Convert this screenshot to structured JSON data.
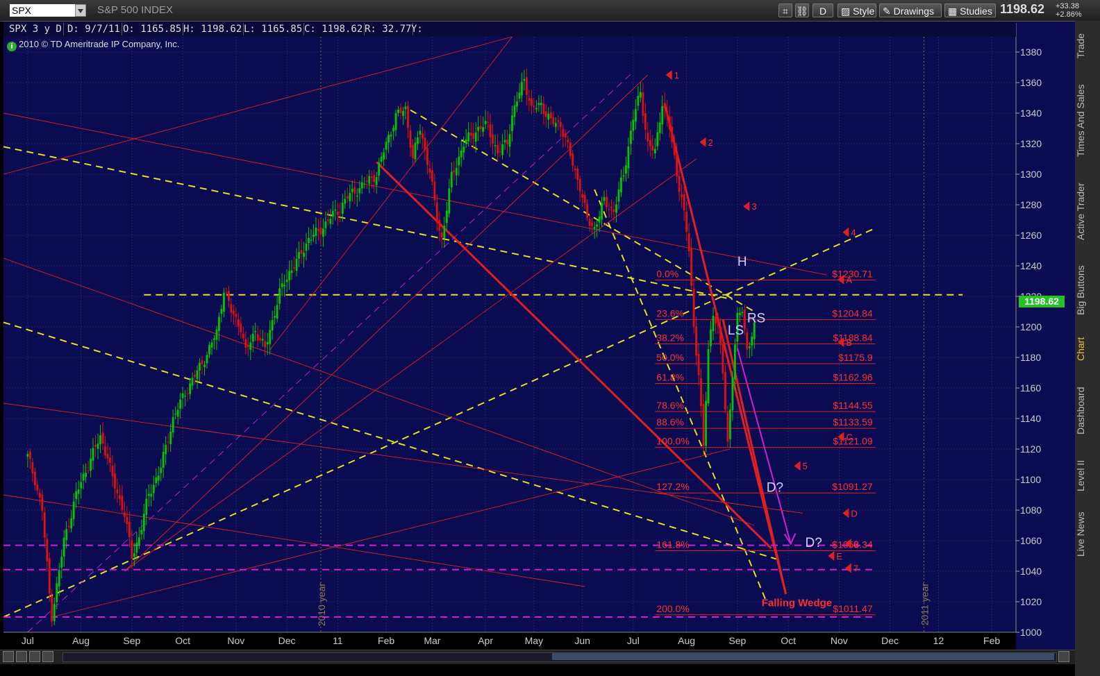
{
  "toolbar": {
    "symbol": "SPX",
    "title": "S&P 500 INDEX",
    "period_button": "D",
    "style_label": "Style",
    "drawings_label": "Drawings",
    "studies_label": "Studies",
    "last_price": "1198.62",
    "change": "+33.38",
    "change_pct": "+2.86%"
  },
  "info_bar": {
    "period": "SPX 3 y D",
    "date": "D: 9/7/11",
    "open": "O: 1165.85",
    "high": "H: 1198.62",
    "low": "L: 1165.85",
    "close": "C: 1198.62",
    "range": "R: 32.77",
    "y": "Y:"
  },
  "copyright": "2010 © TD Ameritrade IP Company, Inc.",
  "right_tabs": [
    "Trade",
    "Times And Sales",
    "Active Trader",
    "Big Buttons",
    "Chart",
    "Dashboard",
    "Level II",
    "Live News"
  ],
  "colors": {
    "background": "#0b0b52",
    "grid": "#5a5a88",
    "up": "#00c800",
    "down": "#e01010",
    "fib": "#e02020",
    "yellow": "#e8e020",
    "magenta": "#d020d0",
    "text_red": "#ff3030",
    "price_tag": "#22c322"
  },
  "chart_data": {
    "type": "candlestick",
    "symbol": "SPX",
    "ylim": [
      1000,
      1390
    ],
    "y_ticks": [
      1000,
      1020,
      1040,
      1060,
      1080,
      1100,
      1120,
      1140,
      1160,
      1180,
      1200,
      1220,
      1240,
      1260,
      1280,
      1300,
      1320,
      1340,
      1360,
      1380
    ],
    "x_labels": [
      "Jul",
      "Aug",
      "Sep",
      "Oct",
      "Nov",
      "Dec",
      "11",
      "Feb",
      "Mar",
      "Apr",
      "May",
      "Jun",
      "Jul",
      "Aug",
      "Sep",
      "Oct",
      "Nov",
      "Dec",
      "12",
      "Feb"
    ],
    "x_tick_index": [
      0,
      22,
      43,
      64,
      86,
      107,
      128,
      148,
      167,
      189,
      209,
      229,
      250,
      272,
      293,
      314,
      335,
      356,
      376,
      398
    ],
    "x_range": [
      -10,
      408
    ],
    "year_markers": [
      {
        "text": "2010 year",
        "x": 121
      },
      {
        "text": "2011 year",
        "x": 370
      }
    ],
    "current_price": "1198.62",
    "price_anchors": [
      [
        0,
        1115
      ],
      [
        3,
        1100
      ],
      [
        6,
        1080
      ],
      [
        9,
        1025
      ],
      [
        10,
        1011
      ],
      [
        12,
        1030
      ],
      [
        15,
        1060
      ],
      [
        20,
        1090
      ],
      [
        25,
        1110
      ],
      [
        30,
        1128
      ],
      [
        33,
        1115
      ],
      [
        35,
        1100
      ],
      [
        40,
        1078
      ],
      [
        43,
        1049
      ],
      [
        46,
        1063
      ],
      [
        50,
        1090
      ],
      [
        55,
        1108
      ],
      [
        60,
        1140
      ],
      [
        66,
        1160
      ],
      [
        72,
        1176
      ],
      [
        78,
        1196
      ],
      [
        81,
        1225
      ],
      [
        84,
        1210
      ],
      [
        88,
        1200
      ],
      [
        90,
        1183
      ],
      [
        94,
        1198
      ],
      [
        98,
        1185
      ],
      [
        100,
        1198
      ],
      [
        104,
        1222
      ],
      [
        108,
        1236
      ],
      [
        112,
        1245
      ],
      [
        116,
        1258
      ],
      [
        120,
        1262
      ],
      [
        124,
        1270
      ],
      [
        128,
        1276
      ],
      [
        132,
        1285
      ],
      [
        136,
        1290
      ],
      [
        140,
        1295
      ],
      [
        144,
        1300
      ],
      [
        148,
        1320
      ],
      [
        152,
        1338
      ],
      [
        156,
        1343
      ],
      [
        159,
        1310
      ],
      [
        162,
        1330
      ],
      [
        166,
        1302
      ],
      [
        169,
        1270
      ],
      [
        171,
        1258
      ],
      [
        175,
        1298
      ],
      [
        180,
        1320
      ],
      [
        186,
        1330
      ],
      [
        190,
        1332
      ],
      [
        194,
        1313
      ],
      [
        198,
        1322
      ],
      [
        200,
        1338
      ],
      [
        205,
        1363
      ],
      [
        208,
        1342
      ],
      [
        212,
        1346
      ],
      [
        216,
        1334
      ],
      [
        220,
        1333
      ],
      [
        224,
        1312
      ],
      [
        228,
        1292
      ],
      [
        231,
        1270
      ],
      [
        234,
        1265
      ],
      [
        238,
        1282
      ],
      [
        242,
        1276
      ],
      [
        246,
        1300
      ],
      [
        250,
        1337
      ],
      [
        253,
        1353
      ],
      [
        256,
        1320
      ],
      [
        259,
        1314
      ],
      [
        262,
        1348
      ],
      [
        265,
        1330
      ],
      [
        268,
        1300
      ],
      [
        270,
        1285
      ],
      [
        273,
        1250
      ],
      [
        275,
        1200
      ],
      [
        277,
        1170
      ],
      [
        279,
        1120
      ],
      [
        281,
        1185
      ],
      [
        283,
        1210
      ],
      [
        285,
        1200
      ],
      [
        287,
        1170
      ],
      [
        289,
        1124
      ],
      [
        291,
        1170
      ],
      [
        293,
        1205
      ],
      [
        295,
        1212
      ],
      [
        297,
        1185
      ],
      [
        300,
        1199
      ]
    ],
    "trendlines": [
      {
        "color": "yellow",
        "dash": true,
        "from": [
          -10,
          1318
        ],
        "to": [
          291,
          1218
        ]
      },
      {
        "color": "yellow",
        "dash": true,
        "from": [
          -10,
          1203
        ],
        "to": [
          309,
          1048
        ]
      },
      {
        "color": "yellow",
        "dash": true,
        "from": [
          -10,
          1010
        ],
        "to": [
          349,
          1264
        ]
      },
      {
        "color": "yellow",
        "dash": true,
        "from": [
          48,
          1221
        ],
        "to": [
          386,
          1221
        ]
      },
      {
        "color": "yellow",
        "dash": true,
        "from": [
          158,
          1342
        ],
        "to": [
          300,
          1210
        ]
      },
      {
        "color": "yellow",
        "dash": true,
        "from": [
          234,
          1290
        ],
        "to": [
          305,
          1020
        ]
      },
      {
        "color": "red",
        "width": 3,
        "from": [
          144,
          1308
        ],
        "to": [
          307,
          1055
        ]
      },
      {
        "color": "red",
        "width": 3,
        "from": [
          263,
          1346
        ],
        "to": [
          313,
          1025
        ]
      },
      {
        "color": "red",
        "width": 3,
        "from": [
          287,
          1205
        ],
        "to": [
          313,
          1025
        ]
      },
      {
        "color": "magenta",
        "width": 2,
        "from": [
          293,
          1186
        ],
        "to": [
          315,
          1058
        ]
      },
      {
        "color": "magenta",
        "dash": true,
        "from": [
          0,
          1000
        ],
        "to": [
          250,
          1367
        ]
      },
      {
        "color": "red",
        "from": [
          -10,
          1340
        ],
        "to": [
          330,
          1234
        ]
      },
      {
        "color": "red",
        "from": [
          -10,
          1300
        ],
        "to": [
          200,
          1390
        ]
      },
      {
        "color": "red",
        "from": [
          -10,
          1245
        ],
        "to": [
          300,
          1070
        ]
      },
      {
        "color": "red",
        "from": [
          -10,
          1150
        ],
        "to": [
          320,
          1078
        ]
      },
      {
        "color": "red",
        "from": [
          -10,
          1090
        ],
        "to": [
          230,
          1030
        ]
      },
      {
        "color": "red",
        "from": [
          40,
          1040
        ],
        "to": [
          256,
          1365
        ]
      },
      {
        "color": "red",
        "from": [
          40,
          1040
        ],
        "to": [
          276,
          1310
        ]
      },
      {
        "color": "red",
        "from": [
          100,
          1185
        ],
        "to": [
          200,
          1390
        ]
      },
      {
        "color": "red",
        "from": [
          10,
          1010
        ],
        "to": [
          290,
          1120
        ]
      }
    ],
    "fib_levels": [
      {
        "pct": "0.0%",
        "price": 1230.71,
        "label": "$1230.71"
      },
      {
        "pct": "23.6%",
        "price": 1204.84,
        "label": "$1204.84"
      },
      {
        "pct": "38.2%",
        "price": 1188.84,
        "label": "$1188.84"
      },
      {
        "pct": "50.0%",
        "price": 1175.9,
        "label": "$1175.9"
      },
      {
        "pct": "61.8%",
        "price": 1162.96,
        "label": "$1162.96"
      },
      {
        "pct": "78.6%",
        "price": 1144.55,
        "label": "$1144.55"
      },
      {
        "pct": "88.6%",
        "price": 1133.59,
        "label": "$1133.59"
      },
      {
        "pct": "100.0%",
        "price": 1121.09,
        "label": "$1121.09"
      },
      {
        "pct": "127.2%",
        "price": 1091.27,
        "label": "$1091.27"
      },
      {
        "pct": "161.8%",
        "price": 1053.34,
        "label": "$1053.34"
      },
      {
        "pct": "200.0%",
        "price": 1011.47,
        "label": "$1011.47"
      }
    ],
    "fib_x_range": [
      259,
      350
    ],
    "magenta_levels": [
      1057,
      1041,
      1010
    ],
    "markers": [
      {
        "text": "1",
        "x": 266,
        "y": 1365
      },
      {
        "text": "2",
        "x": 280,
        "y": 1321
      },
      {
        "text": "3",
        "x": 298,
        "y": 1279
      },
      {
        "text": "4",
        "x": 339,
        "y": 1262
      },
      {
        "text": "A",
        "x": 337,
        "y": 1231
      },
      {
        "text": "B",
        "x": 337,
        "y": 1190
      },
      {
        "text": "C",
        "x": 337,
        "y": 1128
      },
      {
        "text": "5",
        "x": 319,
        "y": 1109
      },
      {
        "text": "D",
        "x": 339,
        "y": 1078
      },
      {
        "text": "6",
        "x": 340,
        "y": 1058
      },
      {
        "text": "E",
        "x": 333,
        "y": 1050
      },
      {
        "text": "7",
        "x": 340,
        "y": 1042
      }
    ],
    "annotations": [
      {
        "text": "H",
        "x": 293,
        "y": 1240,
        "color": "#d0d0ff"
      },
      {
        "text": "LS",
        "x": 289,
        "y": 1195,
        "color": "#d0d0ff"
      },
      {
        "text": "RS",
        "x": 297,
        "y": 1203,
        "color": "#d0d0ff"
      },
      {
        "text": "D?",
        "x": 305,
        "y": 1092,
        "color": "#d0d0ff"
      },
      {
        "text": "D?",
        "x": 321,
        "y": 1056,
        "color": "#d0d0ff"
      },
      {
        "text": "Falling Wedge",
        "x": 303,
        "y": 1017,
        "color": "#ff3030"
      }
    ]
  }
}
